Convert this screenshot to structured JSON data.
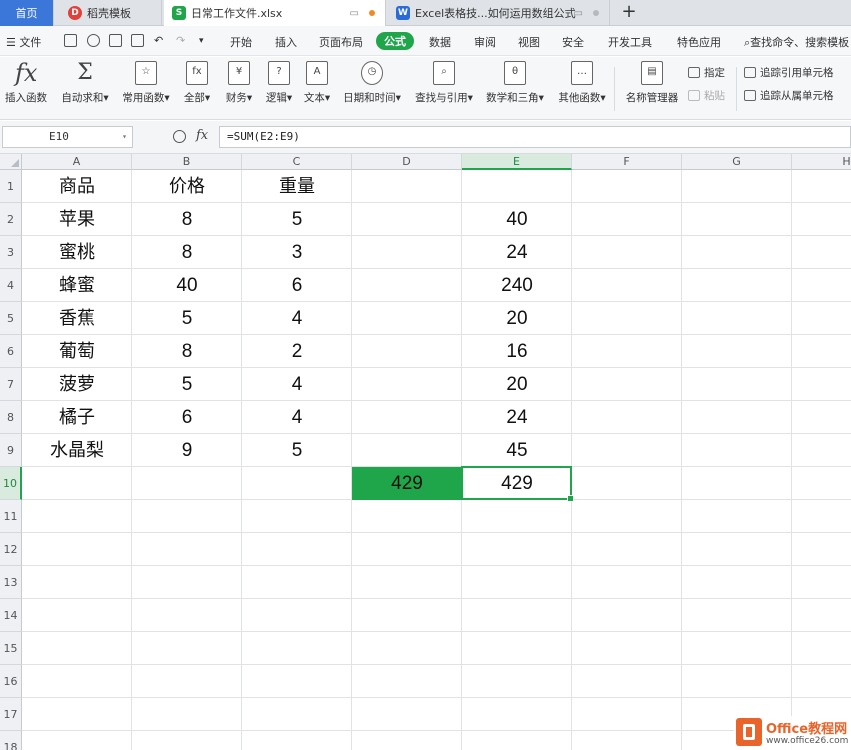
{
  "tabs": [
    {
      "label": "首页",
      "type": "home"
    },
    {
      "label": "稻壳模板",
      "type": "docer",
      "icon_color": "#e0413a"
    },
    {
      "label": "日常工作文件.xlsx",
      "type": "active",
      "icon_color": "#1fa64a"
    },
    {
      "label": "Excel表格技...如何运用数组公式",
      "type": "doc",
      "icon_color": "#2a6bd8"
    }
  ],
  "menu": {
    "file_label": "文件",
    "items": [
      "开始",
      "插入",
      "页面布局",
      "公式",
      "数据",
      "审阅",
      "视图",
      "安全",
      "开发工具",
      "特色应用"
    ],
    "active_item": "公式",
    "search_label": "查找命令、搜索模板"
  },
  "ribbon": {
    "insert_function": "插入函数",
    "autosum": "自动求和",
    "common_functions": "常用函数",
    "all": "全部",
    "financial": "财务",
    "logical": "逻辑",
    "text": "文本",
    "datetime": "日期和时间",
    "lookup": "查找与引用",
    "math": "数学和三角",
    "other": "其他函数",
    "name_manager": "名称管理器",
    "pin": "指定",
    "paste": "粘贴",
    "trace_precedents": "追踪引用单元格",
    "trace_dependents": "追踪从属单元格"
  },
  "formula_bar": {
    "name_box": "E10",
    "fx_label": "fx",
    "formula": "=SUM(E2:E9)"
  },
  "columns": [
    "A",
    "B",
    "C",
    "D",
    "E",
    "F",
    "G",
    "H"
  ],
  "selected_column": "E",
  "rows": [
    "1",
    "2",
    "3",
    "4",
    "5",
    "6",
    "7",
    "8",
    "9",
    "10",
    "11",
    "12",
    "13",
    "14",
    "15",
    "16",
    "17",
    "18"
  ],
  "selected_row": "10",
  "sheet": {
    "headers": [
      "商品",
      "价格",
      "重量"
    ],
    "data": [
      {
        "product": "苹果",
        "price": "8",
        "weight": "5",
        "total": "40"
      },
      {
        "product": "蜜桃",
        "price": "8",
        "weight": "3",
        "total": "24"
      },
      {
        "product": "蜂蜜",
        "price": "40",
        "weight": "6",
        "total": "240"
      },
      {
        "product": "香蕉",
        "price": "5",
        "weight": "4",
        "total": "20"
      },
      {
        "product": "葡萄",
        "price": "8",
        "weight": "2",
        "total": "16"
      },
      {
        "product": "菠萝",
        "price": "5",
        "weight": "4",
        "total": "20"
      },
      {
        "product": "橘子",
        "price": "6",
        "weight": "4",
        "total": "24"
      },
      {
        "product": "水晶梨",
        "price": "9",
        "weight": "5",
        "total": "45"
      }
    ],
    "d10": "429",
    "e10": "429",
    "highlight_color": "#1fa64a"
  },
  "watermark": {
    "brand": "Office教程网",
    "url": "www.office26.com"
  }
}
